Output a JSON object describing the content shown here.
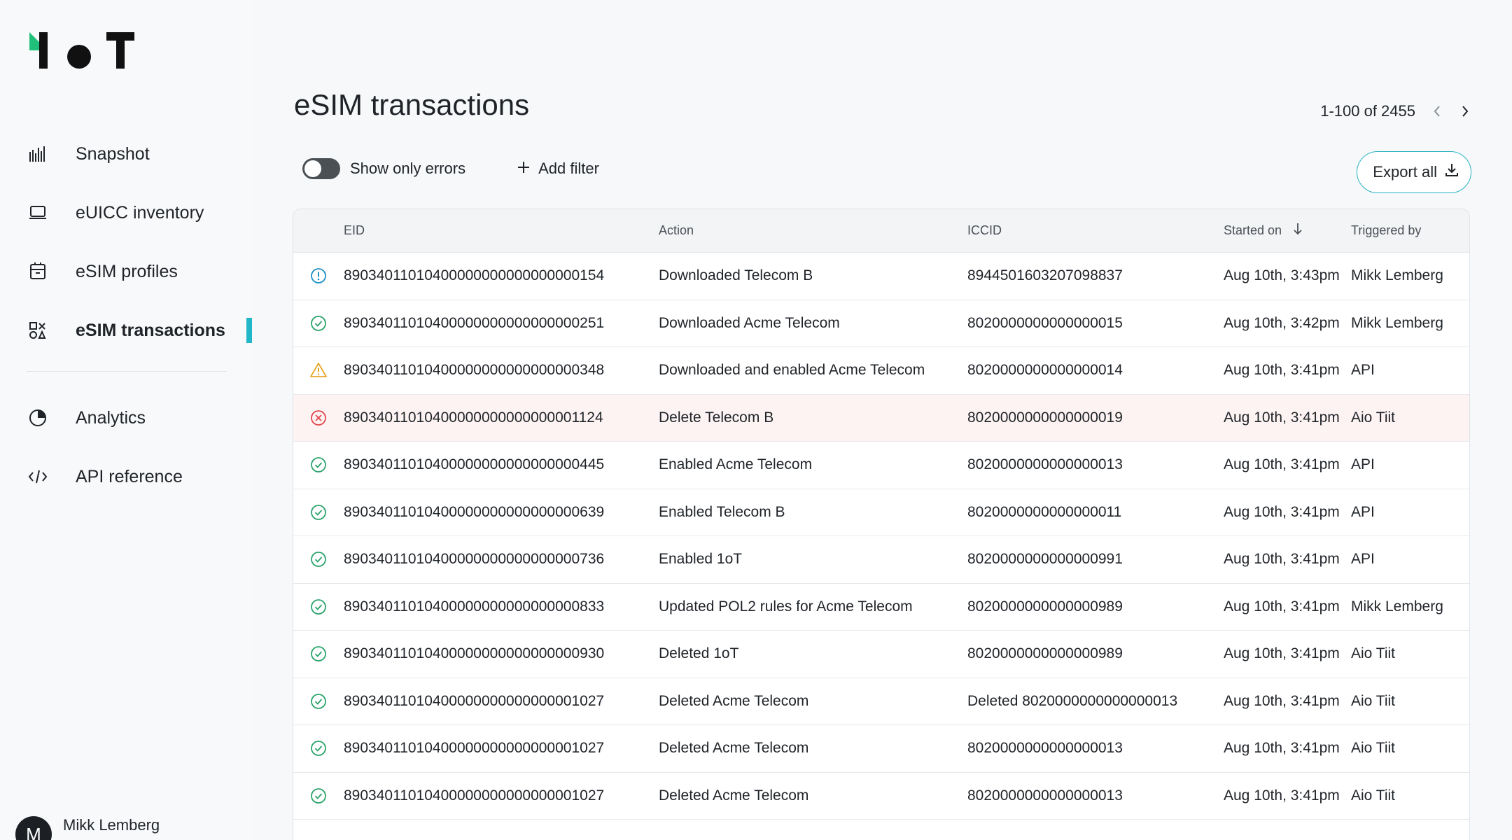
{
  "brand": {
    "logo_text": "1oT",
    "accent": "#21c07a"
  },
  "sidebar": {
    "items": [
      {
        "label": "Snapshot",
        "icon": "bar-chart-icon"
      },
      {
        "label": "eUICC inventory",
        "icon": "laptop-icon"
      },
      {
        "label": "eSIM profiles",
        "icon": "sim-card-icon"
      },
      {
        "label": "eSIM transactions",
        "icon": "shapes-icon",
        "active": true
      },
      {
        "label": "Analytics",
        "icon": "pie-chart-icon"
      },
      {
        "label": "API reference",
        "icon": "code-icon"
      }
    ],
    "user": {
      "initial": "M",
      "name": "Mikk Lemberg"
    }
  },
  "page": {
    "title": "eSIM transactions",
    "pagination": "1-100 of 2455",
    "toggle_label": "Show only errors",
    "add_filter_label": "Add filter",
    "export_label": "Export all"
  },
  "table": {
    "headers": {
      "eid": "EID",
      "action": "Action",
      "iccid": "ICCID",
      "started": "Started on",
      "triggered": "Triggered by"
    },
    "rows": [
      {
        "status": "info",
        "eid": "89034011010400000000000000000154",
        "action": "Downloaded Telecom B",
        "iccid": "8944501603207098837",
        "started": "Aug 10th, 3:43pm",
        "triggered": "Mikk Lemberg"
      },
      {
        "status": "success",
        "eid": "89034011010400000000000000000251",
        "action": "Downloaded Acme Telecom",
        "iccid": "8020000000000000015",
        "started": "Aug 10th, 3:42pm",
        "triggered": "Mikk Lemberg"
      },
      {
        "status": "warning",
        "eid": "89034011010400000000000000000348",
        "action": "Downloaded and enabled Acme Telecom",
        "iccid": "8020000000000000014",
        "started": "Aug 10th, 3:41pm",
        "triggered": "API"
      },
      {
        "status": "error",
        "eid": "89034011010400000000000000001124",
        "action": "Delete Telecom B",
        "iccid": "8020000000000000019",
        "started": "Aug 10th, 3:41pm",
        "triggered": "Aio Tiit"
      },
      {
        "status": "success",
        "eid": "89034011010400000000000000000445",
        "action": "Enabled Acme Telecom",
        "iccid": "8020000000000000013",
        "started": "Aug 10th, 3:41pm",
        "triggered": "API"
      },
      {
        "status": "success",
        "eid": "89034011010400000000000000000639",
        "action": "Enabled Telecom B",
        "iccid": "8020000000000000011",
        "started": "Aug 10th, 3:41pm",
        "triggered": "API"
      },
      {
        "status": "success",
        "eid": "89034011010400000000000000000736",
        "action": "Enabled 1oT",
        "iccid": "8020000000000000991",
        "started": "Aug 10th, 3:41pm",
        "triggered": "API"
      },
      {
        "status": "success",
        "eid": "89034011010400000000000000000833",
        "action": "Updated POL2 rules for Acme Telecom",
        "iccid": "8020000000000000989",
        "started": "Aug 10th, 3:41pm",
        "triggered": "Mikk Lemberg"
      },
      {
        "status": "success",
        "eid": "89034011010400000000000000000930",
        "action": "Deleted 1oT",
        "iccid": "8020000000000000989",
        "started": "Aug 10th, 3:41pm",
        "triggered": "Aio Tiit"
      },
      {
        "status": "success",
        "eid": "89034011010400000000000000001027",
        "action": "Deleted Acme Telecom",
        "iccid": "Deleted 8020000000000000013",
        "started": "Aug 10th, 3:41pm",
        "triggered": "Aio Tiit"
      },
      {
        "status": "success",
        "eid": "89034011010400000000000000001027",
        "action": "Deleted Acme Telecom",
        "iccid": "8020000000000000013",
        "started": "Aug 10th, 3:41pm",
        "triggered": "Aio Tiit"
      },
      {
        "status": "success",
        "eid": "89034011010400000000000000001027",
        "action": "Deleted Acme Telecom",
        "iccid": "8020000000000000013",
        "started": "Aug 10th, 3:41pm",
        "triggered": "Aio Tiit"
      }
    ]
  },
  "colors": {
    "success": "#2ba36b",
    "info": "#1d8fc2",
    "warning": "#e8a72a",
    "error": "#e0474d",
    "active_indicator": "#22b7c8"
  }
}
